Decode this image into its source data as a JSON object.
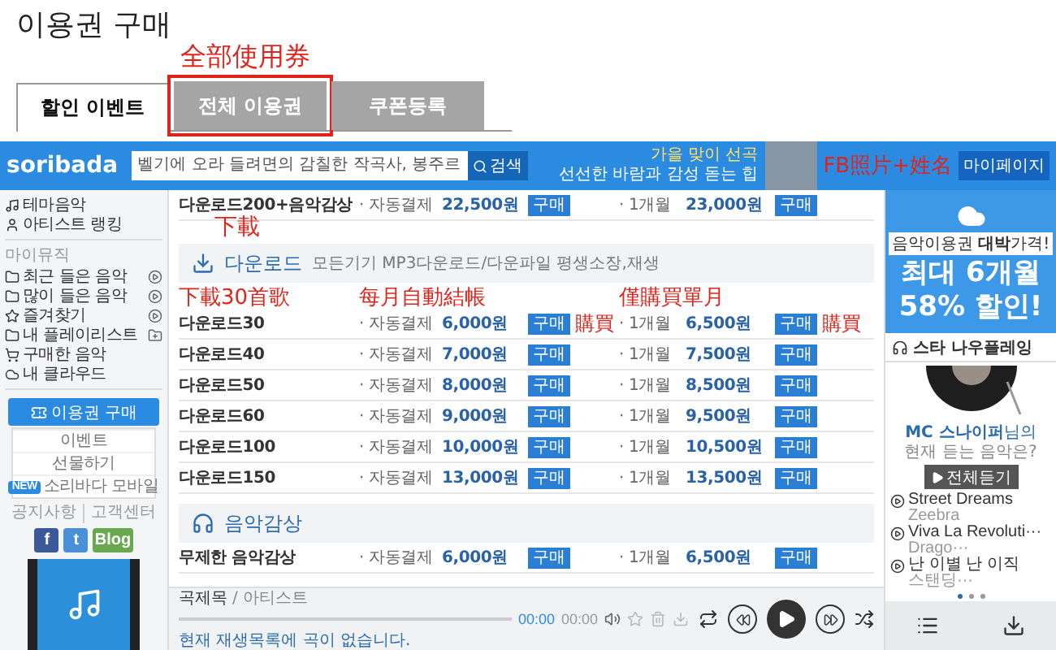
{
  "page_title": "이용권 구매",
  "tabs": [
    {
      "label": "할인 이벤트",
      "selected": true,
      "annotated": false
    },
    {
      "label": "전체 이용권",
      "selected": false,
      "annotated": true,
      "annotation": "全部使用券"
    },
    {
      "label": "쿠폰등록",
      "selected": false,
      "annotated": false
    }
  ],
  "site_header": {
    "logo": "soribada",
    "search": {
      "value": "벨기에 오라 들려면의 감칠한 작곡사, 봉주르"
    },
    "search_button": "검색",
    "promo": [
      "가을 맞이 선곡",
      "선선한 바람과 감성 돋는 힙"
    ],
    "annotation": "FB照片+姓名",
    "mypage_button": "마이페이지"
  },
  "sidebar": {
    "items": [
      {
        "kind": "theme",
        "label": "테마음악"
      },
      {
        "kind": "ranking",
        "label": "아티스트 랭킹"
      }
    ],
    "section_label": "마이뮤직",
    "my_items": [
      {
        "kind": "folder",
        "label": "최근 들은 음악",
        "trailing": {
          "kind": "play"
        }
      },
      {
        "kind": "folder",
        "label": "많이 들은 음악",
        "trailing": {
          "kind": "play"
        }
      },
      {
        "kind": "star",
        "label": "즐겨찾기",
        "trailing": {
          "kind": "play"
        }
      },
      {
        "kind": "folder",
        "label": "내 플레이리스트",
        "trailing": {
          "kind": "folder"
        }
      },
      {
        "kind": "cart",
        "label": "구매한 음악"
      },
      {
        "kind": "cloud",
        "label": "내 클라우드"
      }
    ],
    "purchase_button": "이용권 구매",
    "menu": [
      {
        "label": "이벤트"
      },
      {
        "label": "선물하기"
      },
      {
        "label": "소리바다 모바일",
        "badge": "NEW"
      }
    ],
    "links": [
      "공지사항",
      "고객센터"
    ],
    "social": [
      {
        "kind": "facebook",
        "label": "f"
      },
      {
        "kind": "twitter",
        "label": "t"
      },
      {
        "kind": "blog",
        "label": "Blog"
      }
    ]
  },
  "plans": {
    "previous_rows": [
      {
        "name": "다운로드200+음악감상",
        "auto_label": "· 자동결제",
        "auto_price": "22,500원",
        "auto_button": "구매",
        "month_label": "· 1개월",
        "month_price": "23,000원",
        "month_button": "구매"
      }
    ],
    "sections": [
      {
        "kind": "download",
        "title": "다운로드",
        "annotation": "下載",
        "description": "모든기기 MP3다운로드/다운파일 평생소장,재생",
        "column_notes": [
          "下載30首歌",
          "每月自動結帳",
          "僅購買單月"
        ],
        "rows": [
          {
            "name": "다운로드30",
            "auto_label": "· 자동결제",
            "auto_price": "6,000원",
            "auto_button": "구매",
            "month_label": "· 1개월",
            "month_price": "6,500원",
            "month_button": "구매",
            "notes": [
              "購買",
              "購買"
            ]
          },
          {
            "name": "다운로드40",
            "auto_label": "· 자동결제",
            "auto_price": "7,000원",
            "auto_button": "구매",
            "month_label": "· 1개월",
            "month_price": "7,500원",
            "month_button": "구매"
          },
          {
            "name": "다운로드50",
            "auto_label": "· 자동결제",
            "auto_price": "8,000원",
            "auto_button": "구매",
            "month_label": "· 1개월",
            "month_price": "8,500원",
            "month_button": "구매"
          },
          {
            "name": "다운로드60",
            "auto_label": "· 자동결제",
            "auto_price": "9,000원",
            "auto_button": "구매",
            "month_label": "· 1개월",
            "month_price": "9,500원",
            "month_button": "구매"
          },
          {
            "name": "다운로드100",
            "auto_label": "· 자동결제",
            "auto_price": "10,000원",
            "auto_button": "구매",
            "month_label": "· 1개월",
            "month_price": "10,500원",
            "month_button": "구매"
          },
          {
            "name": "다운로드150",
            "auto_label": "· 자동결제",
            "auto_price": "13,000원",
            "auto_button": "구매",
            "month_label": "· 1개월",
            "month_price": "13,500원",
            "month_button": "구매"
          }
        ]
      },
      {
        "kind": "listening",
        "title": "음악감상",
        "rows": [
          {
            "name": "무제한 음악감상",
            "auto_label": "· 자동결제",
            "auto_price": "6,000원",
            "auto_button": "구매",
            "month_label": "· 1개월",
            "month_price": "6,500원",
            "month_button": "구매"
          }
        ]
      }
    ]
  },
  "player": {
    "title": "곡제목",
    "artist": "/ 아티스트",
    "level": 0,
    "elapsed": "00:00",
    "total": "00:00",
    "message": "현재 재생목록에 곡이 없습니다."
  },
  "right_panel": {
    "ad": {
      "headline": "음악이용권 **대박**가격!",
      "line1": "최대 **6개월**",
      "line2": "**58%** 할인!"
    },
    "now_playing": {
      "title": "스타 나우플레잉",
      "user_line": "**MC 스나이퍼**님의",
      "question": "현재 듣는 음악은?",
      "button": "전체듣기",
      "songs": [
        {
          "title": "Street Dreams",
          "artist": "Zeebra"
        },
        {
          "title": "Viva La Revoluti···",
          "artist": "Drago···"
        },
        {
          "title": "난 이별 난 이직",
          "artist": "스탠딩···"
        }
      ]
    }
  }
}
